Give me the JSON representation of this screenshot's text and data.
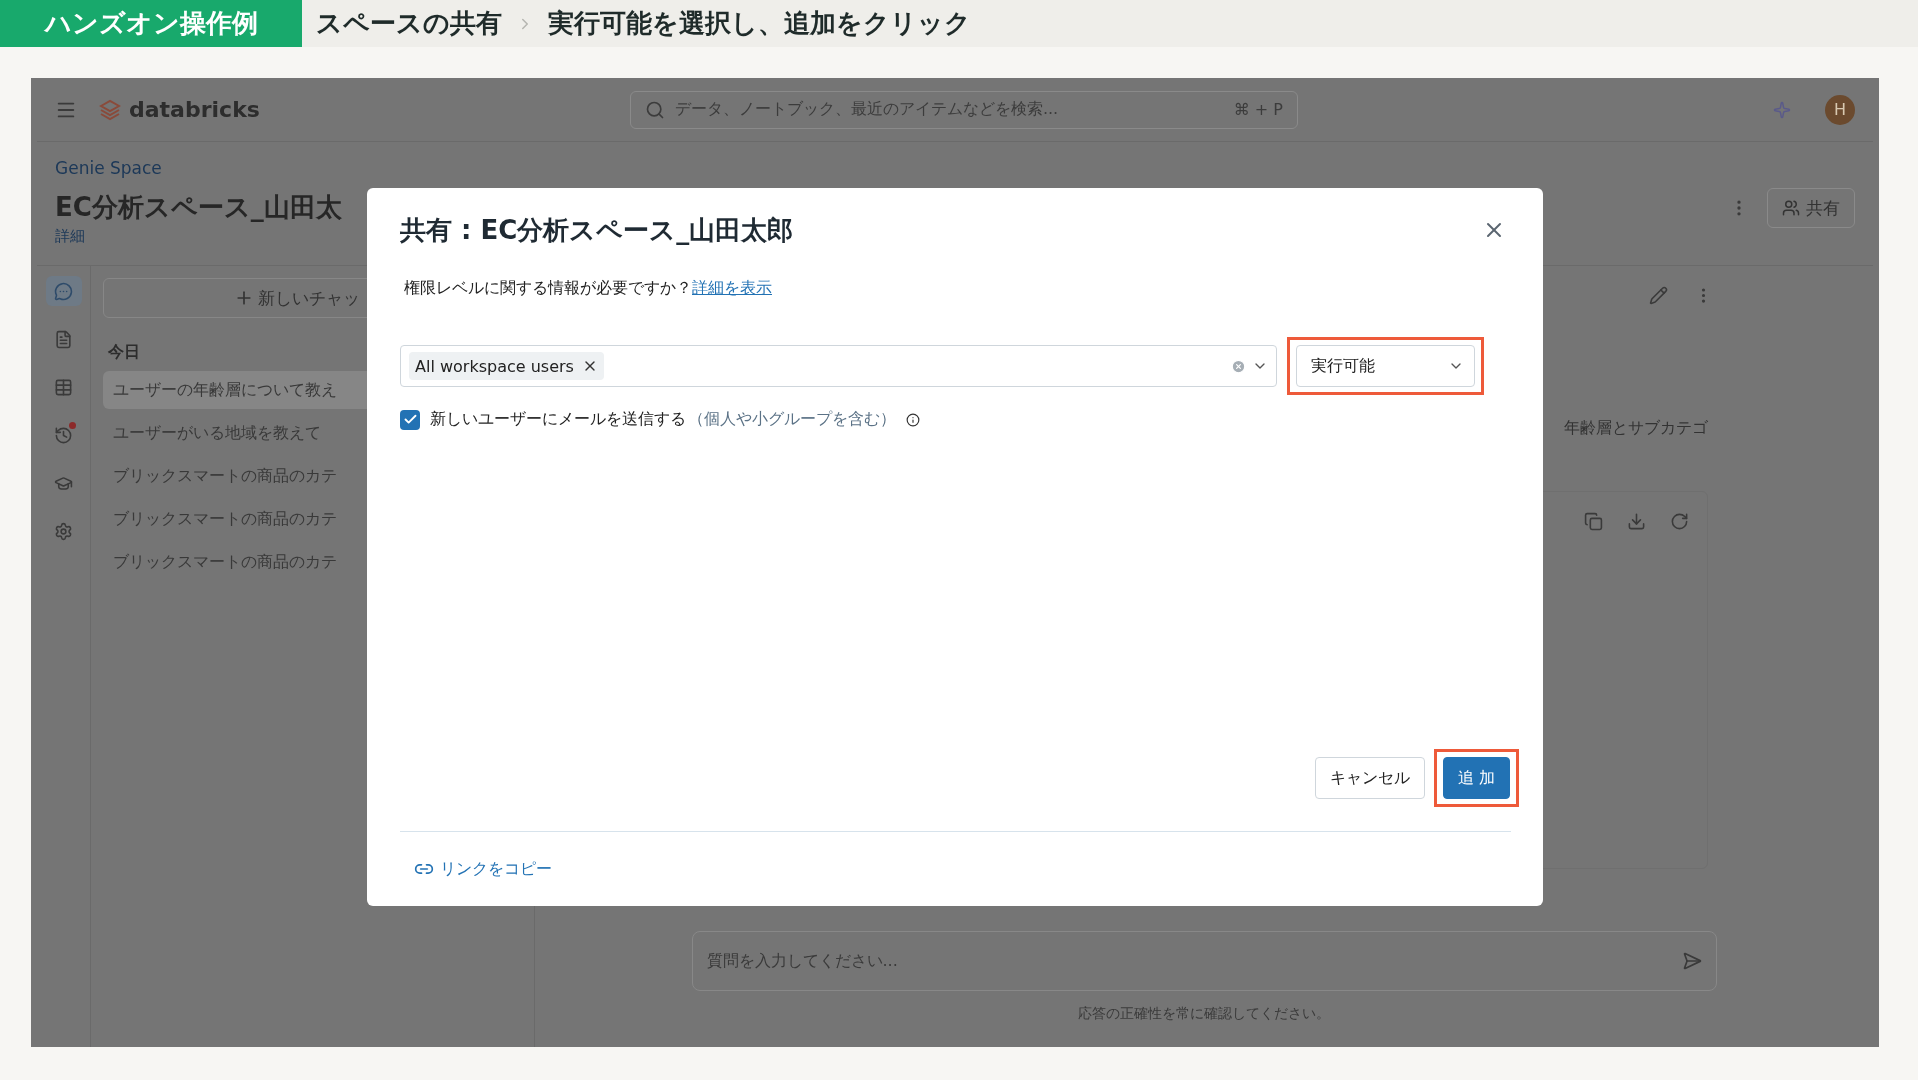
{
  "banner": {
    "tag": "ハンズオン操作例",
    "steps": [
      "スペースの共有",
      "実行可能を選択し、追加をクリック"
    ]
  },
  "app": {
    "brand": "databricks",
    "search": {
      "placeholder": "データ、ノートブック、最近のアイテムなどを検索...",
      "shortcut": "⌘ + P"
    },
    "avatar": "H",
    "page": {
      "breadcrumb": "Genie Space",
      "title": "EC分析スペース_山田太",
      "details_link": "詳細",
      "share_button": "共有"
    },
    "rail": [
      {
        "kind": "chat",
        "selected": true,
        "alert": false
      },
      {
        "kind": "instructions",
        "selected": false,
        "alert": false
      },
      {
        "kind": "data",
        "selected": false,
        "alert": false
      },
      {
        "kind": "history",
        "selected": false,
        "alert": true
      },
      {
        "kind": "learning",
        "selected": false,
        "alert": false
      },
      {
        "kind": "settings",
        "selected": false,
        "alert": false
      }
    ],
    "chats": {
      "new_chat": "新しいチャッ",
      "groups": [
        {
          "label": "今日",
          "items": [
            {
              "title": "ユーザーの年齢層について教え",
              "selected": true
            },
            {
              "title": "ユーザーがいる地域を教えて",
              "selected": false
            },
            {
              "title": "ブリックスマートの商品のカテ",
              "selected": false
            },
            {
              "title": "ブリックスマートの商品のカテ",
              "selected": false
            },
            {
              "title": "ブリックスマートの商品のカテ",
              "selected": false
            }
          ]
        }
      ]
    },
    "main": {
      "message_fragment": "年齢層とサブカテゴ",
      "question": {
        "placeholder": "質問を入力してください..."
      },
      "disclaimer": "応答の正確性を常に確認してください。"
    }
  },
  "dialog": {
    "title": "共有 : EC分析スペース_山田太郎",
    "help_text": "権限レベルに関する情報が必要ですか？",
    "help_link": "詳細を表示",
    "principals": [
      {
        "label": "All workspace users"
      }
    ],
    "permission": {
      "value": "実行可能",
      "highlighted": true
    },
    "notify": {
      "checked": true,
      "label": "新しいユーザーにメールを送信する",
      "hint": "（個人や小グループを含む）"
    },
    "buttons": [
      {
        "label": "キャンセル",
        "kind": "secondary",
        "highlighted": false
      },
      {
        "label": "追 加",
        "kind": "primary",
        "highlighted": true
      }
    ],
    "copy_link": "リンクをコピー"
  }
}
